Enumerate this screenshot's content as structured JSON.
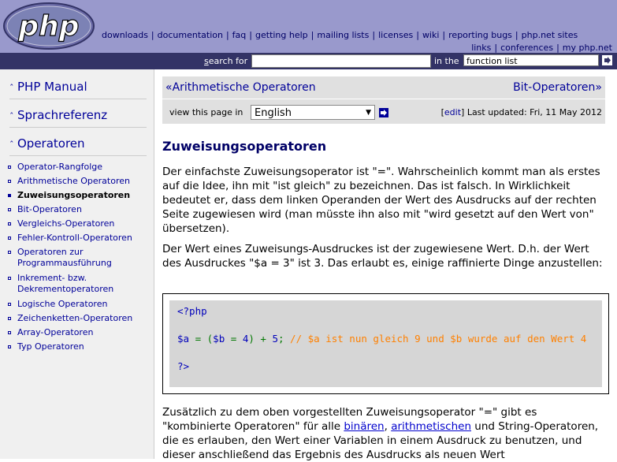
{
  "header": {
    "logo_text": "php",
    "nav_row1": [
      "downloads",
      "documentation",
      "faq",
      "getting help",
      "mailing lists",
      "licenses",
      "wiki",
      "reporting bugs",
      "php.net sites"
    ],
    "nav_row2": [
      "links",
      "conferences",
      "my php.net"
    ]
  },
  "search": {
    "label_prefix": "s",
    "label_rest": "earch for",
    "value": "",
    "in_the": "in the",
    "scope": "function list"
  },
  "sidebar": {
    "sections": [
      "PHP Manual",
      "Sprachreferenz",
      "Operatoren"
    ],
    "items": [
      "Operator-Rangfolge",
      "Arithmetische Operatoren",
      "Zuweisungsoperatoren",
      "Bit-Operatoren",
      "Vergleichs-Operatoren",
      "Fehler-Kontroll-Operatoren",
      "Operatoren zur Programmausführung",
      "Inkrement- bzw. Dekrementoperatoren",
      "Logische Operatoren",
      "Zeichenketten-Operatoren",
      "Array-Operatoren",
      "Typ Operatoren"
    ],
    "active_index": 2
  },
  "pagenav": {
    "prev": "Arithmetische Operatoren",
    "next": "Bit-Operatoren",
    "view_label": "view this page in",
    "language": "English",
    "edit": "edit",
    "last_updated": "Last updated: Fri, 11 May 2012"
  },
  "content": {
    "title": "Zuweisungsoperatoren",
    "para1": "Der einfachste Zuweisungsoperator ist \"=\". Wahrscheinlich kommt man als erstes auf die Idee, ihn mit \"ist gleich\" zu bezeichnen. Das ist falsch. In Wirklichkeit bedeutet er, dass dem linken Operanden der Wert des Ausdrucks auf der rechten Seite zugewiesen wird (man müsste ihn also mit \"wird gesetzt auf den Wert von\" übersetzen).",
    "para2": "Der Wert eines Zuweisungs-Ausdruckes ist der zugewiesene Wert. D.h. der Wert des Ausdruckes \"$a = 3\" ist 3. Das erlaubt es, einige raffinierte Dinge anzustellen:",
    "code_open": "<?php",
    "code_var_a": "$a",
    "code_eq": " = (",
    "code_var_b": "$b",
    "code_eq2": " = ",
    "code_num4": "4",
    "code_plus": ") + ",
    "code_num5": "5",
    "code_semi": "; ",
    "code_comment": "// $a ist nun gleich 9 und $b wurde auf den Wert 4",
    "code_close": "?>",
    "para3_start": "Zusätzlich zu dem oben vorgestellten Zuweisungsoperator \"=\" gibt es \"kombinierte Operatoren\" für alle ",
    "para3_link1": "binären",
    "para3_comma": ", ",
    "para3_link2": "arithmetischen",
    "para3_end": " und String-Operatoren, die es erlauben, den Wert einer Variablen in einem Ausdruck zu benutzen, und dieser anschließend das Ergebnis des Ausdrucks als neuen Wert"
  },
  "colors": {
    "header_bg": "#9999cc",
    "search_bg": "#333366",
    "link": "#000099",
    "title": "#000066",
    "comment": "#ff8000"
  }
}
